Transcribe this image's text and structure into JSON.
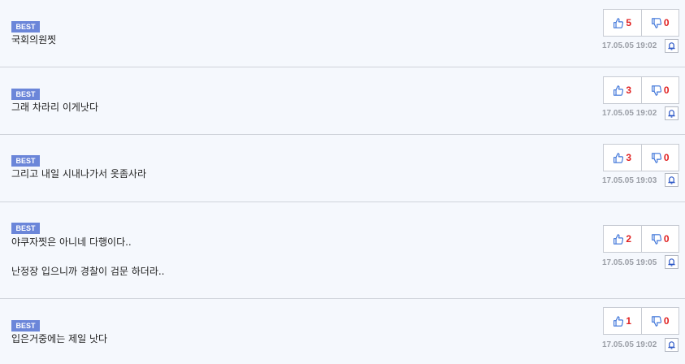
{
  "comments": [
    {
      "badge": "BEST",
      "lines": [
        "국회의원찟"
      ],
      "up": "5",
      "down": "0",
      "date": "17.05.05 19:02"
    },
    {
      "badge": "BEST",
      "lines": [
        "그래 차라리 이게낫다"
      ],
      "up": "3",
      "down": "0",
      "date": "17.05.05 19:02"
    },
    {
      "badge": "BEST",
      "lines": [
        "그리고 내일 시내나가서 옷좀사라"
      ],
      "up": "3",
      "down": "0",
      "date": "17.05.05 19:03"
    },
    {
      "badge": "BEST",
      "lines": [
        "야쿠자찟은 아니네 다행이다..",
        "난정장 입으니까 경찰이 검문 하더라.."
      ],
      "up": "2",
      "down": "0",
      "date": "17.05.05 19:05"
    },
    {
      "badge": "BEST",
      "lines": [
        "입은거중에는 제일 낫다"
      ],
      "up": "1",
      "down": "0",
      "date": "17.05.05 19:02"
    }
  ],
  "icons": {
    "up": "thumbs-up-icon",
    "down": "thumbs-down-icon",
    "report": "bell-icon"
  },
  "colors": {
    "badge": "#6b86d9",
    "vote_count": "#e02020",
    "thumb": "#3b73d9"
  }
}
